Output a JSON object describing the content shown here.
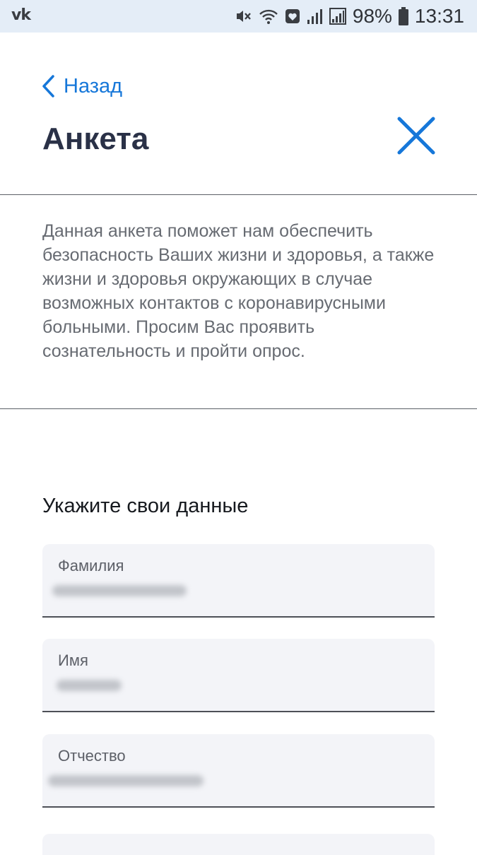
{
  "status_bar": {
    "left_logo": "vk",
    "icons": [
      "mute-icon",
      "wifi-icon",
      "heart-notification-icon",
      "signal-icon",
      "signal-icon-2"
    ],
    "battery_percent": "98%",
    "battery_icon": "battery-icon",
    "time": "13:31"
  },
  "header": {
    "back_label": "Назад",
    "back_icon": "chevron-left-icon",
    "title": "Анкета",
    "close_icon": "close-icon",
    "accent": "#1677d9"
  },
  "intro": {
    "text": "Данная анкета поможет нам обеспечить безопасность Ваших жизни и здоровья, а также жизни и здоровья окружающих в случае возможных контактов с коронавирусными больными. Просим Вас проявить сознательность и пройти опрос."
  },
  "form": {
    "section_title": "Укажите свои данные",
    "fields": [
      {
        "label": "Фамилия",
        "value": ""
      },
      {
        "label": "Имя",
        "value": ""
      },
      {
        "label": "Отчество",
        "value": ""
      }
    ]
  }
}
